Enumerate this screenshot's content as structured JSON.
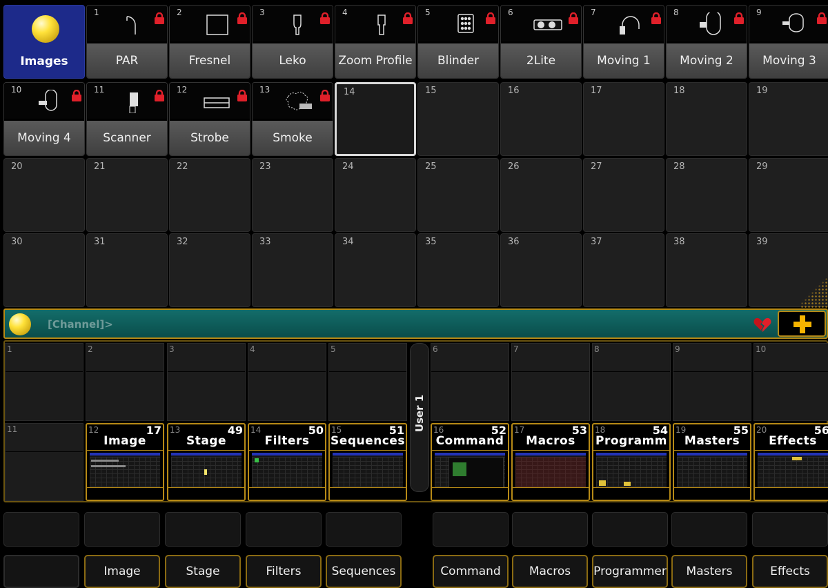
{
  "pool": {
    "images_label": "Images",
    "filled": [
      {
        "num": "1",
        "label": "PAR"
      },
      {
        "num": "2",
        "label": "Fresnel"
      },
      {
        "num": "3",
        "label": "Leko"
      },
      {
        "num": "4",
        "label": "Zoom Profile"
      },
      {
        "num": "5",
        "label": "Blinder"
      },
      {
        "num": "6",
        "label": "2Lite"
      },
      {
        "num": "7",
        "label": "Moving 1"
      },
      {
        "num": "8",
        "label": "Moving 2"
      },
      {
        "num": "9",
        "label": "Moving 3"
      },
      {
        "num": "10",
        "label": "Moving 4"
      },
      {
        "num": "11",
        "label": "Scanner"
      },
      {
        "num": "12",
        "label": "Strobe"
      },
      {
        "num": "13",
        "label": "Smoke"
      }
    ],
    "empty": [
      "14",
      "15",
      "16",
      "17",
      "18",
      "19",
      "20",
      "21",
      "22",
      "23",
      "24",
      "25",
      "26",
      "27",
      "28",
      "29",
      "30",
      "31",
      "32",
      "33",
      "34",
      "35",
      "36",
      "37",
      "38",
      "39"
    ],
    "selected_slot": "14"
  },
  "cmdline": {
    "prompt": "[Channel]>"
  },
  "views": {
    "user_tab": "User 1",
    "empty_slots": [
      "1",
      "2",
      "3",
      "4",
      "5",
      "6",
      "7",
      "8",
      "9",
      "10",
      "11"
    ],
    "buttons": [
      {
        "num": "12",
        "count": "17",
        "name": "Image"
      },
      {
        "num": "13",
        "count": "49",
        "name": "Stage"
      },
      {
        "num": "14",
        "count": "50",
        "name": "Filters"
      },
      {
        "num": "15",
        "count": "51",
        "name": "Sequences"
      },
      {
        "num": "16",
        "count": "52",
        "name": "Command"
      },
      {
        "num": "17",
        "count": "53",
        "name": "Macros"
      },
      {
        "num": "18",
        "count": "54",
        "name": "Programm"
      },
      {
        "num": "19",
        "count": "55",
        "name": "Masters"
      },
      {
        "num": "20",
        "count": "56",
        "name": "Effects"
      }
    ]
  },
  "bottom_keys": [
    "Image",
    "Stage",
    "Filters",
    "Sequences",
    "Command",
    "Macros",
    "Programmer",
    "Masters",
    "Effects"
  ],
  "colors": {
    "accent": "#b78a16",
    "cmdline": "#0f5e5b",
    "images_tile": "#1d2a8a",
    "lock": "#e0202a"
  }
}
